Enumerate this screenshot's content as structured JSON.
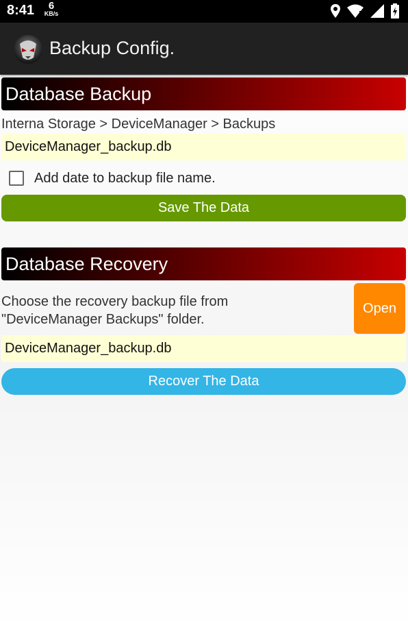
{
  "status_bar": {
    "time": "8:41",
    "net_speed_value": "6",
    "net_speed_unit": "KB/s",
    "icons": [
      "location-icon",
      "wifi-icon",
      "signal-icon",
      "battery-charging-icon"
    ]
  },
  "app_bar": {
    "title": "Backup Config.",
    "logo_icon": "alien-mask-icon"
  },
  "backup": {
    "header": "Database Backup",
    "path": "Interna Storage > DeviceManager > Backups",
    "file_name": "DeviceManager_backup.db",
    "add_date_label": "Add date to backup file name.",
    "add_date_checked": false,
    "save_button": "Save The Data"
  },
  "recovery": {
    "header": "Database Recovery",
    "instruction_line1": "Choose the recovery backup file from",
    "instruction_line2": "\"DeviceManager Backups\" folder.",
    "open_button": "Open",
    "file_name": "DeviceManager_backup.db",
    "recover_button": "Recover The Data"
  },
  "colors": {
    "status_bar": "#000000",
    "app_bar": "#212121",
    "header_gradient_end": "#c80000",
    "file_field_bg": "#ffffd5",
    "save_button": "#669900",
    "open_button": "#ff8800",
    "recover_button": "#33b5e5"
  }
}
